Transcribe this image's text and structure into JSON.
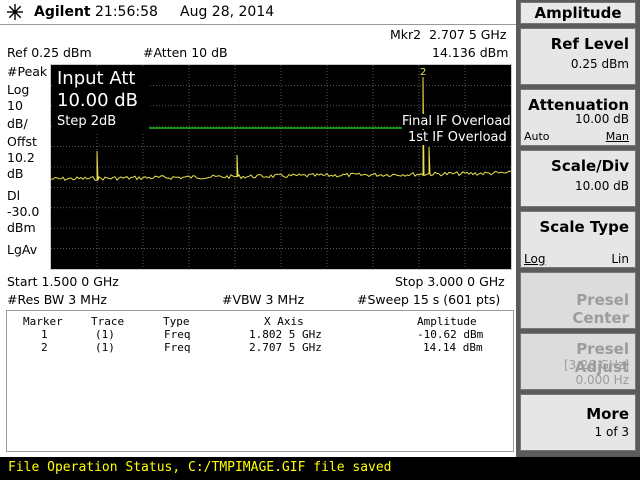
{
  "header": {
    "brand": "Agilent",
    "time": "21:56:58",
    "date": "Aug 28, 2014"
  },
  "marker_readout": {
    "freq": "Mkr2  2.707 5 GHz",
    "amp": "14.136 dBm"
  },
  "top_info": {
    "ref": "Ref 0.25 dBm",
    "atten": "#Atten 10 dB"
  },
  "left_labels": {
    "peak": "#Peak",
    "log": "Log",
    "scale_val": "10",
    "scale_unit": "dB/",
    "offst": "Offst",
    "offst_val": "10.2",
    "offst_unit": "dB",
    "dl": "Dl",
    "dl_val": "-30.0",
    "dl_unit": "dBm",
    "lgav": "LgAv"
  },
  "popup": {
    "title": "Input Att",
    "value": "10.00 dB",
    "step": "Step 2dB"
  },
  "overload": {
    "final": "Final IF Overload",
    "first": "1st IF Overload"
  },
  "marker_label": "2",
  "bottom_info": {
    "start": "Start 1.500 0 GHz",
    "stop": "Stop 3.000 0 GHz",
    "rbw": "#Res BW 3 MHz",
    "vbw": "#VBW 3 MHz",
    "sweep": "#Sweep 15 s (601 pts)"
  },
  "marker_table": {
    "headers": [
      "Marker",
      "Trace",
      "Type",
      "X Axis",
      "Amplitude"
    ],
    "rows": [
      [
        "1",
        "(1)",
        "Freq",
        "1.802 5 GHz",
        "-10.62 dBm"
      ],
      [
        "2",
        "(1)",
        "Freq",
        "2.707 5 GHz",
        "14.14 dBm"
      ]
    ]
  },
  "status": "File Operation Status, C:/TMPIMAGE.GIF file saved",
  "softkeys": {
    "header": "Amplitude",
    "ref_level": {
      "label": "Ref Level",
      "value": "0.25 dBm"
    },
    "attenuation": {
      "label": "Attenuation",
      "value": "10.00 dB",
      "auto": "Auto",
      "man": "Man"
    },
    "scale_div": {
      "label": "Scale/Div",
      "value": "10.00 dB"
    },
    "scale_type": {
      "label": "Scale Type",
      "log": "Log",
      "lin": "Lin"
    },
    "presel_center": {
      "label": "Presel Center"
    },
    "presel_adjust": {
      "label": "Presel Adjust",
      "range": "[3-26 GHz]",
      "value": "0.000  Hz"
    },
    "more": {
      "label": "More",
      "value": "1 of 3"
    }
  },
  "colors": {
    "trace": "#e8e04a",
    "display_line": "#19c519",
    "status_text": "#ffff00",
    "grid": "#8a8a8a"
  }
}
